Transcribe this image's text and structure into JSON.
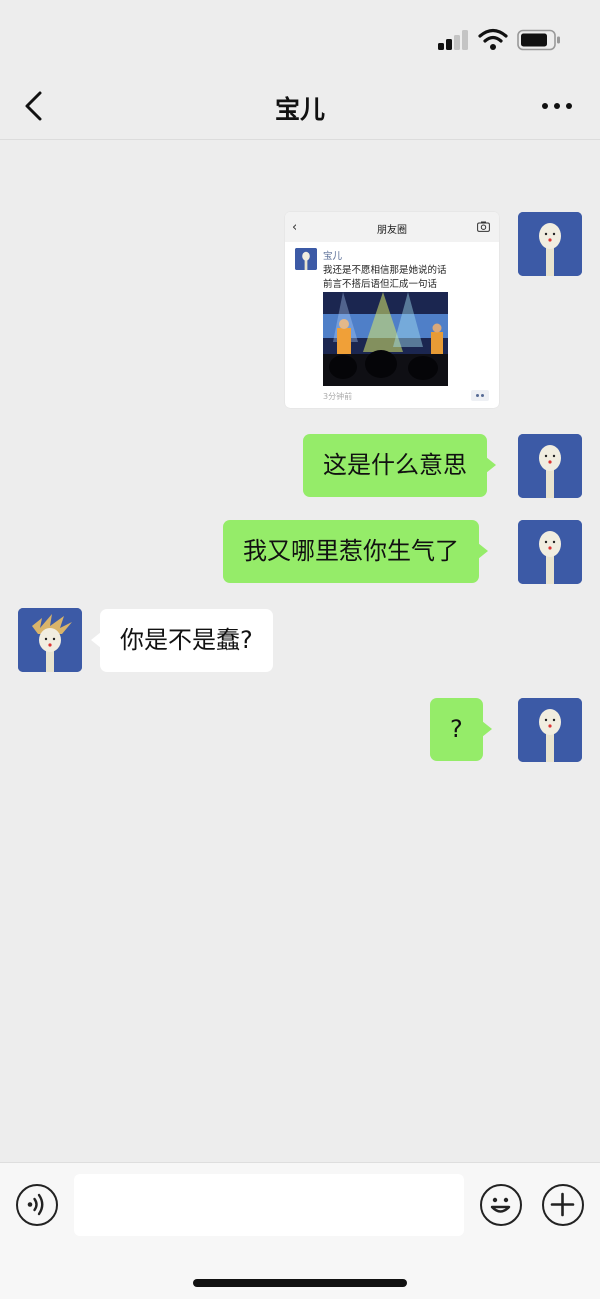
{
  "header": {
    "title": "宝儿",
    "back_icon": "chevron-left-icon",
    "more_icon": "more-dots-icon"
  },
  "status_bar": {
    "icons": [
      "signal-icon",
      "wifi-icon",
      "battery-icon"
    ]
  },
  "messages": [
    {
      "sender": "me",
      "type": "screenshot",
      "screenshot": {
        "title": "朋友圈",
        "name": "宝儿",
        "lines": [
          "我还是不愿相信那是她说的话",
          "前言不搭后语但汇成一句话"
        ],
        "time": "3分钟前",
        "camera_icon": "camera-icon"
      }
    },
    {
      "sender": "me",
      "type": "text",
      "text": "这是什么意思"
    },
    {
      "sender": "me",
      "type": "text",
      "text": "我又哪里惹你生气了"
    },
    {
      "sender": "them",
      "type": "text",
      "text": "你是不是蠢?"
    },
    {
      "sender": "me",
      "type": "text",
      "text": "?"
    }
  ],
  "input_bar": {
    "placeholder": "",
    "voice_icon": "voice-icon",
    "emoji_icon": "emoji-icon",
    "plus_icon": "plus-icon"
  },
  "colors": {
    "background": "#ededed",
    "my_bubble": "#95ec69",
    "their_bubble": "#ffffff",
    "avatar_bg": "#3c5aa6",
    "link_name": "#576b95"
  }
}
